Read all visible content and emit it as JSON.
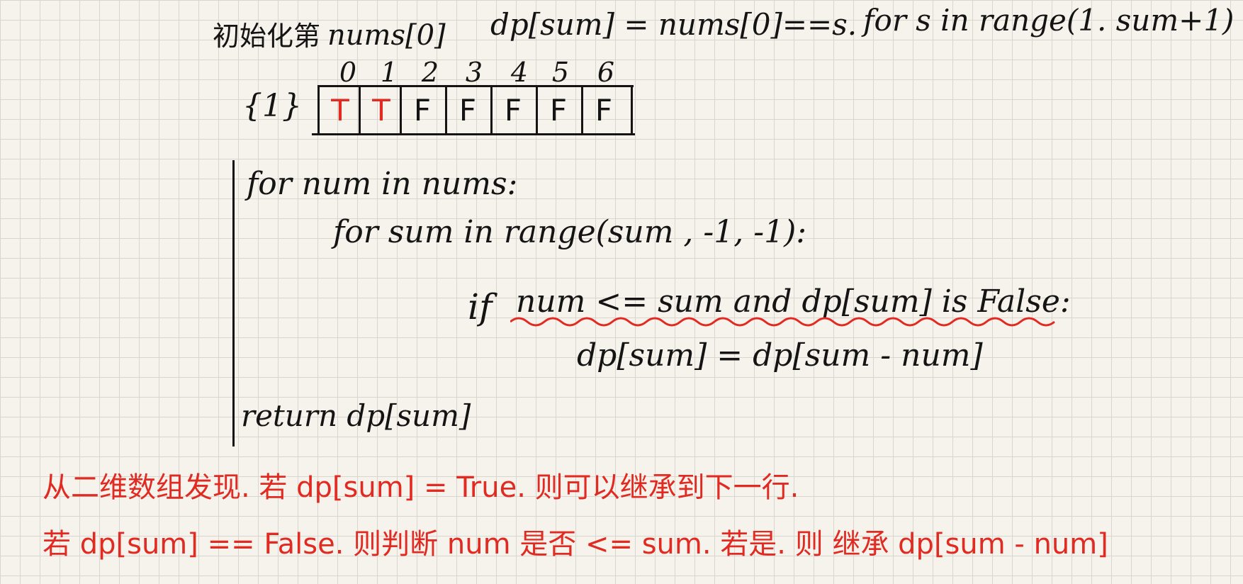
{
  "header": {
    "init_label": "初始化第",
    "init_nums": "nums[0]",
    "dp_eq": "dp[sum] = nums[0]==s.",
    "for_range": "for s in range(1. sum+1)"
  },
  "array": {
    "set_label": "{1}",
    "indices": [
      "0",
      "1",
      "2",
      "3",
      "4",
      "5",
      "6"
    ],
    "cells": [
      "T",
      "T",
      "F",
      "F",
      "F",
      "F",
      "F"
    ],
    "highlight_color": "#e02a22"
  },
  "code": {
    "line1": "for num in nums:",
    "line2": "for sum in range(sum , -1, -1):",
    "line3_if": "if",
    "line3_cond": "num <= sum and dp[sum] is False:",
    "line4": "dp[sum] = dp[sum - num]",
    "line5": "return dp[sum]"
  },
  "notes": {
    "line1": "从二维数组发现. 若 dp[sum] = True. 则可以继承到下一行.",
    "line2": "若 dp[sum] == False. 则判断 num 是否 <= sum. 若是. 则 继承 dp[sum - num]"
  },
  "colors": {
    "ink": "#141414",
    "red": "#e02a22",
    "paper": "#f6f3ec",
    "grid": "#d9d6cf"
  }
}
